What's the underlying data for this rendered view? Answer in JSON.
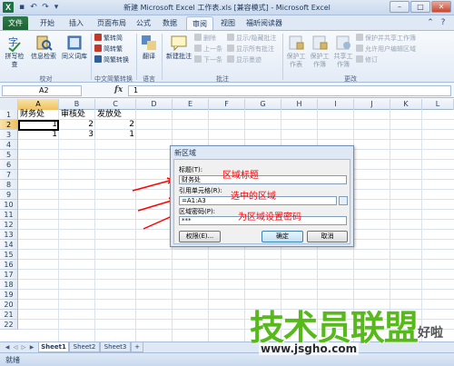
{
  "window": {
    "title": "新建 Microsoft Excel 工作表.xls  [兼容模式] - Microsoft Excel",
    "app_icon": "X"
  },
  "tabs": [
    "文件",
    "开始",
    "插入",
    "页面布局",
    "公式",
    "数据",
    "审阅",
    "视图",
    "福昕阅读器"
  ],
  "ribbon": {
    "proofing": {
      "spell": "拼写检查",
      "research": "信息检索",
      "thesaurus": "同义词库",
      "group": "校对"
    },
    "chinese": {
      "to_trad": "繁转简",
      "to_simp": "简转繁",
      "convert": "简繁转换",
      "group": "中文简繁转换"
    },
    "language": {
      "translate": "翻译",
      "group": "语言"
    },
    "comments": {
      "new": "新建批注",
      "delete": "删除",
      "prev": "上一条",
      "next": "下一条",
      "show_hide": "显示/隐藏批注",
      "show_all": "显示所有批注",
      "show_ink": "显示墨迹",
      "group": "批注"
    },
    "changes": {
      "protect_sheet": "保护工作表",
      "protect_wb": "保护工作簿",
      "share_wb": "共享工作簿",
      "protect_share": "保护并共享工作簿",
      "allow_edit": "允许用户编辑区域",
      "track": "修订",
      "group": "更改"
    }
  },
  "formula_bar": {
    "name_box": "A2",
    "fx": "fx",
    "value": "1"
  },
  "columns": [
    "A",
    "B",
    "C",
    "D",
    "E",
    "F",
    "G",
    "H",
    "I",
    "J",
    "K",
    "L",
    "M"
  ],
  "rows": [
    "1",
    "2",
    "3",
    "4",
    "5",
    "6",
    "7",
    "8",
    "9",
    "10",
    "11",
    "12",
    "13",
    "14",
    "15",
    "16",
    "17",
    "18",
    "19",
    "20",
    "21",
    "22"
  ],
  "cells": {
    "a1": "财务处",
    "b1": "审核处",
    "c1": "发放处",
    "a2": "1",
    "b2": "2",
    "c2": "2",
    "a3": "1",
    "b3": "3",
    "c3": "1"
  },
  "dialog": {
    "title": "新区域",
    "title_label": "标题(T):",
    "title_value": "财务处",
    "ref_label": "引用单元格(R):",
    "ref_value": "=A1:A3",
    "pwd_label": "区域密码(P):",
    "pwd_value": "***",
    "perm_button": "权限(E)...",
    "ok_button": "确定",
    "cancel_button": "取消"
  },
  "annotations": {
    "title": "区域标题",
    "range": "选中的区域",
    "password": "为区域设置密码"
  },
  "sheets": [
    "Sheet1",
    "Sheet2",
    "Sheet3"
  ],
  "status": "就绪",
  "watermark": {
    "brand": "技术员联盟",
    "url": "www.jsgho.com",
    "side": "好啦"
  }
}
